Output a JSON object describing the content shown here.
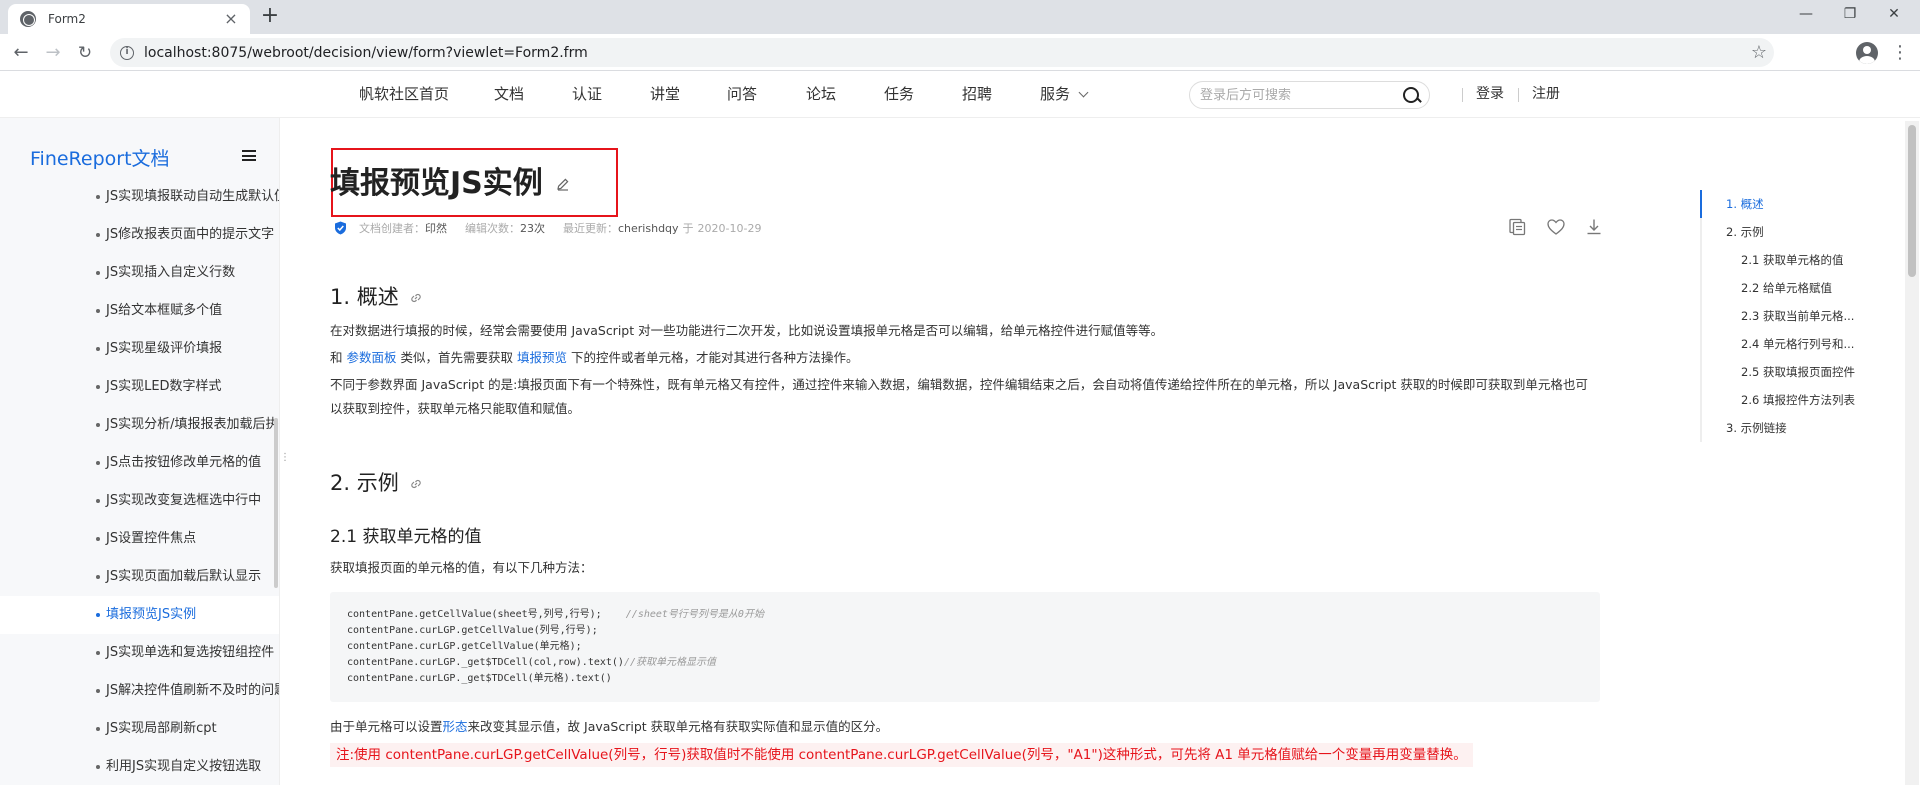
{
  "browser": {
    "tab_title": "Form2",
    "tab_close": "×",
    "new_tab": "+",
    "win_min": "—",
    "win_max": "❐",
    "win_close": "✕",
    "url": "localhost:8075/webroot/decision/view/form?viewlet=Form2.frm",
    "back": "←",
    "forward": "→",
    "reload": "↻",
    "star": "☆",
    "menu": "⋮"
  },
  "header": {
    "nav": [
      "帆软社区首页",
      "文档",
      "认证",
      "讲堂",
      "问答",
      "论坛",
      "任务",
      "招聘",
      "服务"
    ],
    "search_placeholder": "登录后方可搜索",
    "login": "登录",
    "register": "注册"
  },
  "sidebar": {
    "brand": "FineReport文档",
    "items": [
      "JS实现填报联动自动生成默认值",
      "JS修改报表页面中的提示文字",
      "JS实现插入自定义行数",
      "JS给文本框赋多个值",
      "JS实现星级评价填报",
      "JS实现LED数字样式",
      "JS实现分析/填报报表加载后执行",
      "JS点击按钮修改单元格的值",
      "JS实现改变复选框选中行中",
      "JS设置控件焦点",
      "JS实现页面加载后默认显示",
      "填报预览JS实例",
      "JS实现单选和复选按钮组控件",
      "JS解决控件值刷新不及时的问题",
      "JS实现局部刷新cpt",
      "利用JS实现自定义按钮选取"
    ],
    "active_index": 11
  },
  "article": {
    "title": "填报预览JS实例",
    "meta": {
      "creator_label": "文档创建者：",
      "creator": "印然",
      "edits_label": "编辑次数：",
      "edits": "23次",
      "updated_label": "最近更新：",
      "updater": "cherishdqy",
      "at": "于",
      "date": "2020-10-29"
    },
    "h_overview": "1. 概述",
    "p1": "在对数据进行填报的时候，经常会需要使用 JavaScript 对一些功能进行二次开发，比如说设置填报单元格是否可以编辑，给单元格控件进行赋值等等。",
    "p2_a": "和 ",
    "p2_link1": "参数面板",
    "p2_b": " 类似，首先需要获取 ",
    "p2_link2": "填报预览",
    "p2_c": " 下的控件或者单元格，才能对其进行各种方法操作。",
    "p3": "不同于参数界面 JavaScript 的是:填报页面下有一个特殊性，既有单元格又有控件，通过控件来输入数据，编辑数据，控件编辑结束之后，会自动将值传递给控件所在的单元格，所以 JavaScript 获取的时候即可获取到单元格也可以获取到控件，获取单元格只能取值和赋值。",
    "h_examples": "2. 示例",
    "h_21": "2.1 获取单元格的值",
    "p4": "获取填报页面的单元格的值，有以下几种方法：",
    "code": [
      {
        "text": "contentPane.getCellValue(sheet号,列号,行号);    ",
        "comment": "//sheet号行号列号是从0开始"
      },
      {
        "text": "contentPane.curLGP.getCellValue(列号,行号);",
        "comment": ""
      },
      {
        "text": "contentPane.curLGP.getCellValue(单元格);",
        "comment": ""
      },
      {
        "text": "contentPane.curLGP._get$TDCell(col,row).text()",
        "comment": "//获取单元格显示值"
      },
      {
        "text": "contentPane.curLGP._get$TDCell(单元格).text()",
        "comment": ""
      }
    ],
    "p5_a": "由于单元格可以设置",
    "p5_link": "形态",
    "p5_b": "来改变其显示值，故 JavaScript 获取单元格有获取实际值和显示值的区分。",
    "note": "注:使用 contentPane.curLGP.getCellValue(列号，行号)获取值时不能使用 contentPane.curLGP.getCellValue(列号，\"A1\")这种形式，可先将 A1 单元格值赋给一个变量再用变量替换。"
  },
  "toc": [
    {
      "label": "1. 概述",
      "level": 1,
      "active": true
    },
    {
      "label": "2. 示例",
      "level": 1
    },
    {
      "label": "2.1 获取单元格的值",
      "level": 2
    },
    {
      "label": "2.2 给单元格赋值",
      "level": 2
    },
    {
      "label": "2.3 获取当前单元格...",
      "level": 2
    },
    {
      "label": "2.4 单元格行列号和...",
      "level": 2
    },
    {
      "label": "2.5 获取填报页面控件",
      "level": 2
    },
    {
      "label": "2.6 填报控件方法列表",
      "level": 2
    },
    {
      "label": "3. 示例链接",
      "level": 1
    }
  ],
  "colors": {
    "accent": "#1a6cdd",
    "highlight": "#e6141b"
  }
}
